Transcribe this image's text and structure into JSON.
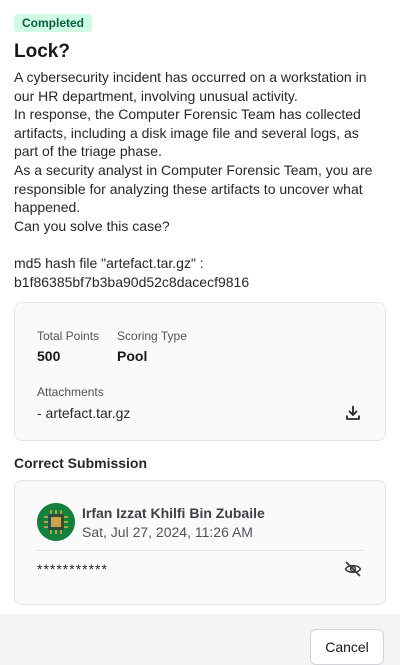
{
  "challenge": {
    "status_badge": "Completed",
    "title": "Lock?",
    "description": [
      "A cybersecurity incident has occurred on a workstation in our HR department, involving unusual activity.",
      "In response, the Computer Forensic Team has collected artifacts, including a disk image file and several logs, as part of the triage phase.",
      "As a security analyst in Computer Forensic Team, you are responsible for analyzing these artifacts to uncover what happened.",
      "Can you solve this case?",
      "",
      "md5 hash file \"artefact.tar.gz\" :",
      "b1f86385bf7b3ba90d52c8dacecf9816"
    ]
  },
  "info": {
    "total_points_label": "Total Points",
    "total_points_value": "500",
    "scoring_type_label": "Scoring Type",
    "scoring_type_value": "Pool",
    "attachments_label": "Attachments",
    "attachment": "- artefact.tar.gz",
    "download_icon": "download-icon"
  },
  "submission": {
    "section_title": "Correct Submission",
    "user_name": "Irfan Izzat Khilfi Bin Zubaile",
    "timestamp": "Sat, Jul 27, 2024, 11:26 AM",
    "masked_answer": "***********",
    "toggle_icon": "eye-off-icon"
  },
  "footer": {
    "cancel_label": "Cancel"
  },
  "colors": {
    "badge_bg": "#d1fae5",
    "badge_text": "#065f46",
    "avatar_green": "#15803d"
  }
}
